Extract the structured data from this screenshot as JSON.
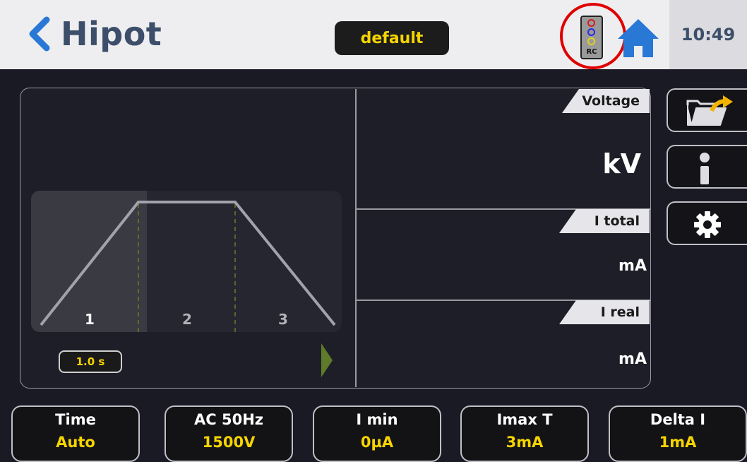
{
  "header": {
    "title": "Hipot",
    "profile": "default",
    "rc_label": "RC",
    "time": "10:49"
  },
  "graph": {
    "segments": [
      "1",
      "2",
      "3"
    ],
    "active_segment": 1,
    "duration": "1.0 s"
  },
  "measurements": [
    {
      "label": "Voltage",
      "unit": "kV"
    },
    {
      "label": "I total",
      "unit": "mA"
    },
    {
      "label": "I real",
      "unit": "mA"
    }
  ],
  "side_buttons": [
    {
      "icon": "folder-open-icon"
    },
    {
      "icon": "info-icon"
    },
    {
      "icon": "gear-icon"
    }
  ],
  "parameters": [
    {
      "label": "Time",
      "value": "Auto"
    },
    {
      "label": "AC 50Hz",
      "value": "1500V"
    },
    {
      "label": "I min",
      "value": "0µA"
    },
    {
      "label": "Imax T",
      "value": "3mA"
    },
    {
      "label": "Delta I",
      "value": "1mA"
    }
  ],
  "colors": {
    "accent_yellow": "#f5d400",
    "header_text": "#3c4e6a",
    "back_chevron": "#2a78d6",
    "home_icon": "#2a78d6",
    "highlight_ring": "#e00000",
    "ramp_arrow": "#5e7a2a"
  }
}
